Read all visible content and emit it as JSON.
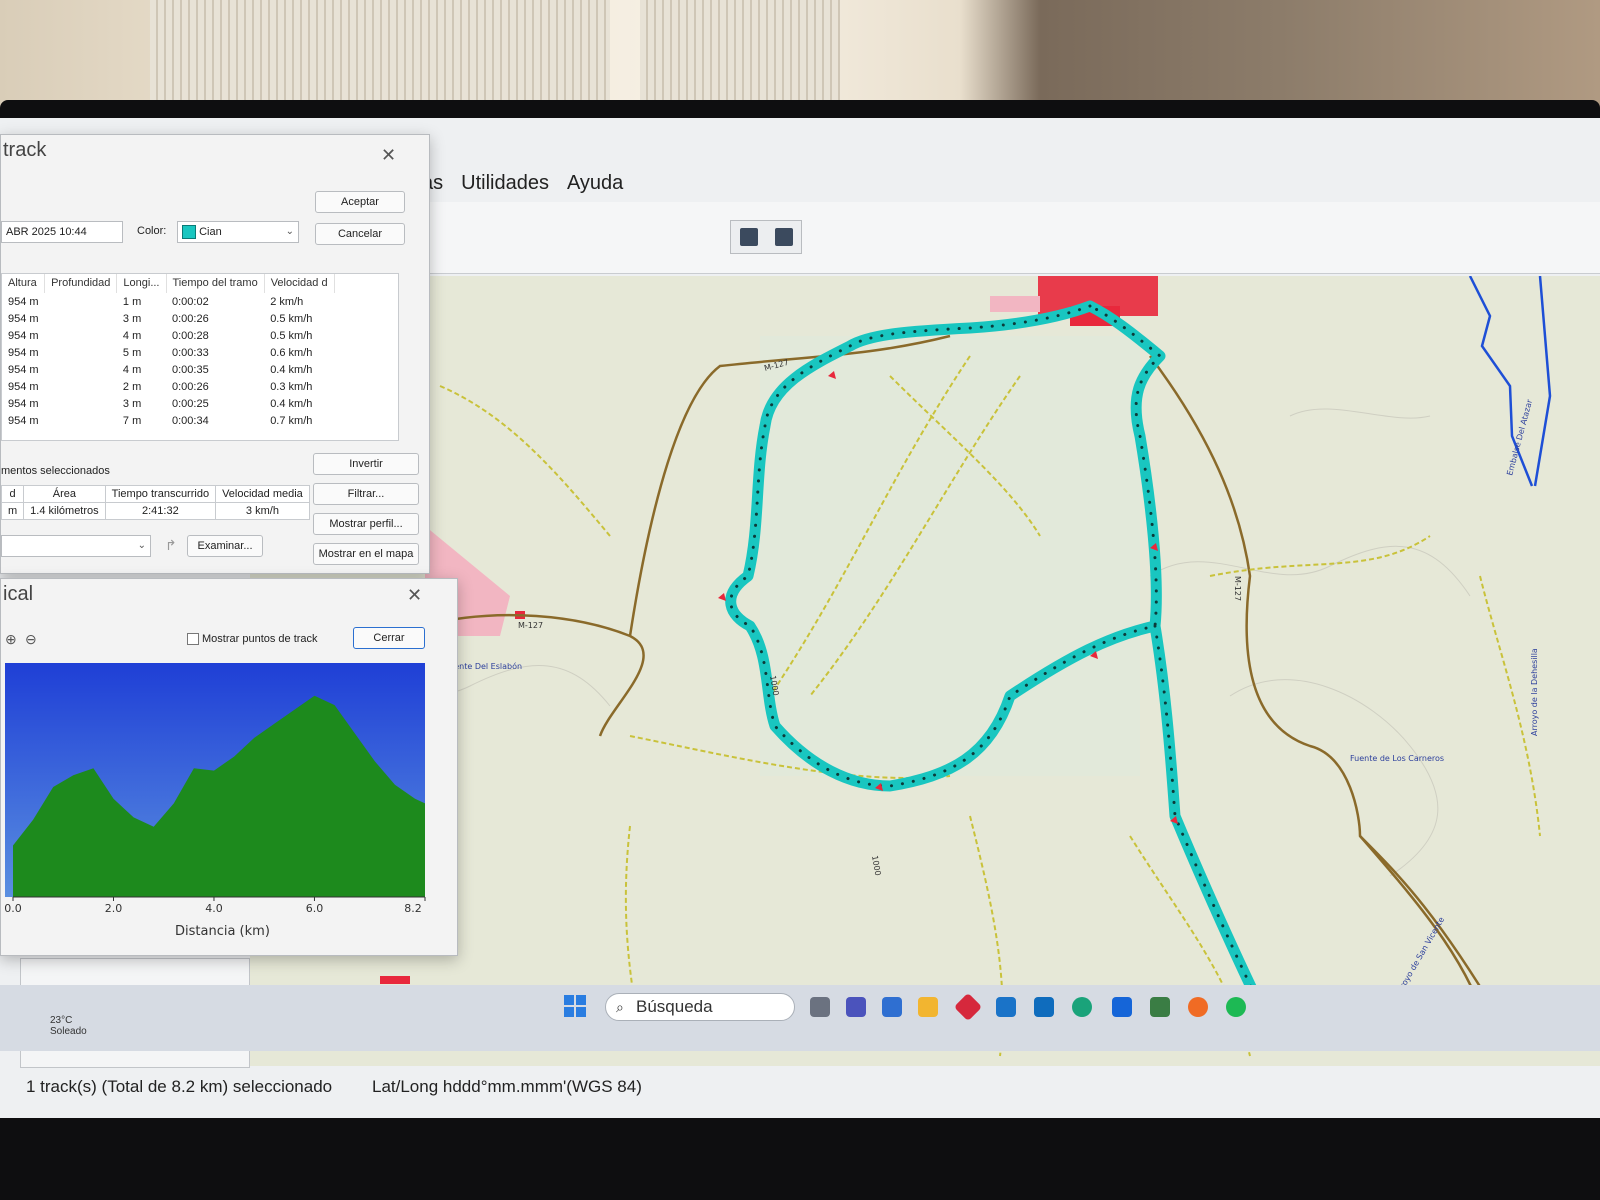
{
  "app": {
    "menu": [
      "as",
      "Utilidades",
      "Ayuda"
    ]
  },
  "track_dialog": {
    "title": "track",
    "date_value": "ABR 2025 10:44",
    "color_label": "Color:",
    "color_value": "Cian",
    "color_hex": "#19c6c0",
    "accept_label": "Aceptar",
    "cancel_label": "Cancelar",
    "columns": [
      "Altura",
      "Profundidad",
      "Longi...",
      "Tiempo del tramo",
      "Velocidad d"
    ],
    "rows": [
      [
        "954 m",
        "",
        "1 m",
        "0:00:02",
        "2 km/h"
      ],
      [
        "954 m",
        "",
        "3 m",
        "0:00:26",
        "0.5 km/h"
      ],
      [
        "954 m",
        "",
        "4 m",
        "0:00:28",
        "0.5 km/h"
      ],
      [
        "954 m",
        "",
        "5 m",
        "0:00:33",
        "0.6 km/h"
      ],
      [
        "954 m",
        "",
        "4 m",
        "0:00:35",
        "0.4 km/h"
      ],
      [
        "954 m",
        "",
        "2 m",
        "0:00:26",
        "0.3 km/h"
      ],
      [
        "954 m",
        "",
        "3 m",
        "0:00:25",
        "0.4 km/h"
      ],
      [
        "954 m",
        "",
        "7 m",
        "0:00:34",
        "0.7 km/h"
      ]
    ],
    "selected_caption": "mentos seleccionados",
    "summary_headers": [
      "d",
      "Área",
      "Tiempo transcurrido",
      "Velocidad media"
    ],
    "summary_values": [
      "m",
      "1.4 kilómetros",
      "2:41:32",
      "3 km/h"
    ],
    "invert_label": "Invertir",
    "filter_label": "Filtrar...",
    "show_profile_label": "Mostrar perfil...",
    "show_map_label": "Mostrar en el mapa",
    "browse_label": "Examinar..."
  },
  "profile_dialog": {
    "title": "ical",
    "show_points_label": "Mostrar puntos de track",
    "close_label": "Cerrar",
    "x_axis_label": "Distancia  (km)",
    "x_ticks": [
      "0.0",
      "2.0",
      "4.0",
      "6.0",
      "8.2"
    ]
  },
  "chart_data": {
    "type": "area",
    "xlabel": "Distancia  (km)",
    "x_tick_labels": [
      "0.0",
      "2.0",
      "4.0",
      "6.0",
      "8.2"
    ],
    "x": [
      0.0,
      0.4,
      0.8,
      1.2,
      1.6,
      2.0,
      2.4,
      2.8,
      3.2,
      3.6,
      4.0,
      4.4,
      4.8,
      5.2,
      5.6,
      6.0,
      6.4,
      6.8,
      7.2,
      7.6,
      8.0,
      8.2
    ],
    "values": [
      0.22,
      0.33,
      0.47,
      0.52,
      0.55,
      0.42,
      0.34,
      0.3,
      0.4,
      0.55,
      0.54,
      0.6,
      0.68,
      0.74,
      0.8,
      0.86,
      0.82,
      0.7,
      0.58,
      0.48,
      0.42,
      0.4
    ],
    "values_unit": "fraction of plot height",
    "fill_color": "#1d8a1d",
    "sky_top": "#1f3fd6",
    "sky_bottom": "#5a8fe0"
  },
  "status": {
    "selection": "1 track(s) (Total de 8.2 km) seleccionado",
    "coords": "Lat/Long hddd°mm.mmm'(WGS 84)"
  },
  "taskbar": {
    "search_placeholder": "Búsqueda",
    "weather_temp": "23°C",
    "weather_desc": "Soleado"
  },
  "map": {
    "track_color": "#19c6c0",
    "road_color": "#8a6a2a",
    "path_color": "#c9c23a",
    "water_color": "#1e4fd6",
    "urban_color": "#e8283c",
    "labels": [
      "M-127",
      "M-127",
      "Fuente Del Eslabón",
      "Embalse Del Atazar",
      "Arroyo de la Dehesilla",
      "Fuente de Los Carneros",
      "Arroyo de San Vicente",
      "M-127",
      "1000",
      "1000"
    ]
  }
}
